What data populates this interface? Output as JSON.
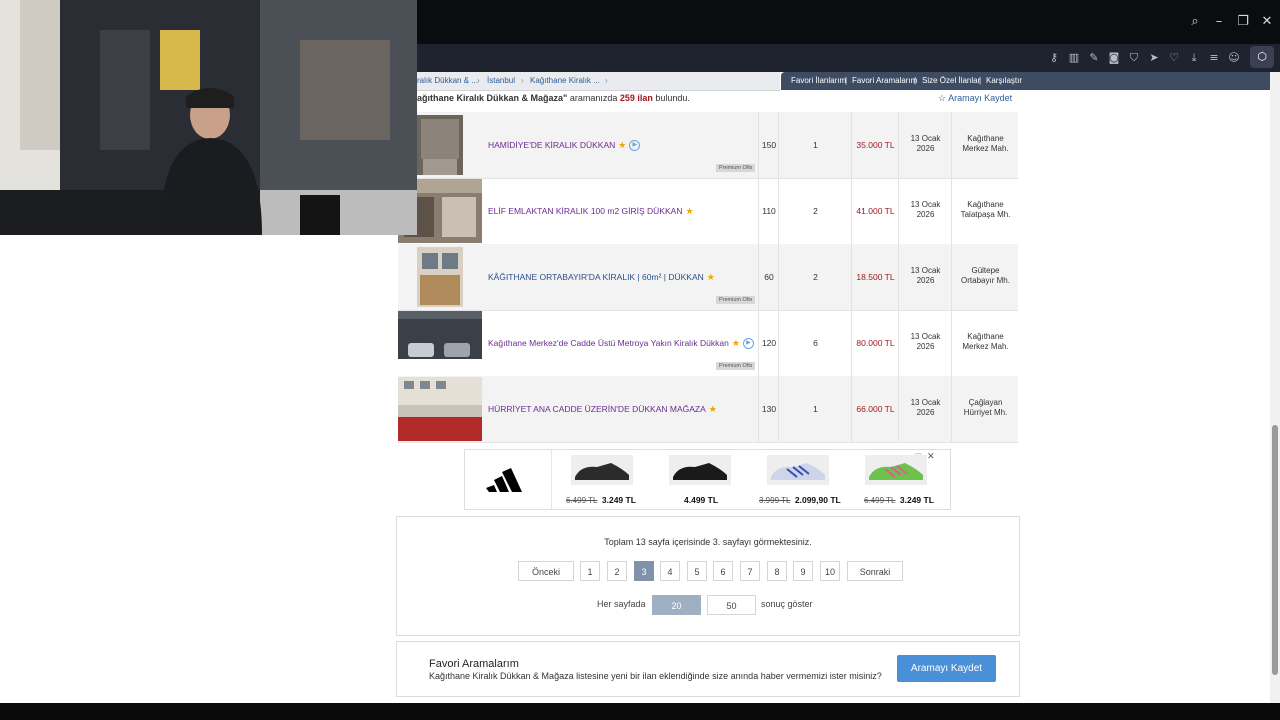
{
  "breadcrumb": [
    "ralık Dükkan & ...",
    "İstanbul",
    "Kağıthane Kiralık ..."
  ],
  "top_links": [
    "Favori İlanlarım",
    "Favori Aramalarım",
    "Size Özel İlanlar",
    "Karşılaştır"
  ],
  "top_links_sep": "|",
  "result": {
    "prefix": "ağıthane Kiralık Dükkan & Mağaza\"",
    "middle": " aramanızda ",
    "count": "259 ilan",
    "suffix": " bulundu.",
    "save": "Aramayı Kaydet"
  },
  "listings": [
    {
      "title": "HAMİDİYE'DE KİRALIK DÜKKAN",
      "m2": "150",
      "rooms": "1",
      "price": "35.000 TL",
      "date1": "13 Ocak",
      "date2": "2026",
      "loc1": "Kağıthane",
      "loc2": "Merkez Mah.",
      "premium": "Premium Ofis"
    },
    {
      "title": "ELİF EMLAKTAN KİRALIK 100 m2 GİRİŞ DÜKKAN",
      "m2": "110",
      "rooms": "2",
      "price": "41.000 TL",
      "date1": "13 Ocak",
      "date2": "2026",
      "loc1": "Kağıthane",
      "loc2": "Talatpaşa Mh."
    },
    {
      "title": "KÂĞITHANE ORTABAYIR'DA KİRALIK | 60m² | DÜKKAN",
      "m2": "60",
      "rooms": "2",
      "price": "18.500 TL",
      "date1": "13 Ocak",
      "date2": "2026",
      "loc1": "Gültepe",
      "loc2": "Ortabayır Mh.",
      "premium": "Premium Ofis"
    },
    {
      "title": "Kağıthane Merkez'de Cadde Üstü Metroya Yakın Kiralık Dükkan",
      "m2": "120",
      "rooms": "6",
      "price": "80.000 TL",
      "date1": "13 Ocak",
      "date2": "2026",
      "loc1": "Kağıthane",
      "loc2": "Merkez Mah.",
      "premium": "Premium Ofis"
    },
    {
      "title": "HÜRRİYET ANA CADDE ÜZERİN'DE DÜKKAN MAĞAZA",
      "m2": "130",
      "rooms": "1",
      "price": "66.000 TL",
      "date1": "13 Ocak",
      "date2": "2026",
      "loc1": "Çağlayan",
      "loc2": "Hürriyet Mh."
    }
  ],
  "ad": {
    "close": "✕",
    "info": "ⓘ",
    "products": [
      {
        "old": "6.499 TL",
        "new": "3.249 TL",
        "color": "#2b2b2b"
      },
      {
        "old": "",
        "new": "4.499 TL",
        "color": "#1a1a1a"
      },
      {
        "old": "3.999 TL",
        "new": "2.099,90 TL",
        "color": "#cfd4e8"
      },
      {
        "old": "6.499 TL",
        "new": "3.249 TL",
        "color": "#6cc24a"
      }
    ]
  },
  "pagination": {
    "info": "Toplam 13 sayfa içerisinde 3. sayfayı görmektesiniz.",
    "prev": "Önceki",
    "next": "Sonraki",
    "pages": [
      "1",
      "2",
      "3",
      "4",
      "5",
      "6",
      "7",
      "8",
      "9",
      "10"
    ],
    "current": "3",
    "per_page_label": "Her sayfada",
    "per_page_options": [
      "20",
      "50"
    ],
    "per_page_selected": "20",
    "per_page_suffix": "sonuç göster"
  },
  "favorites": {
    "title": "Favori Aramalarım",
    "description": "Kağıthane Kiralık Dükkan & Mağaza listesine yeni bir ilan eklendiğinde size anında haber vermemizi ister misiniz?",
    "button": "Aramayı Kaydet"
  },
  "colors": {
    "accent": "#4a90d9",
    "price": "#a1181f",
    "link": "#6b2c91",
    "active_page": "#7f92a9"
  }
}
